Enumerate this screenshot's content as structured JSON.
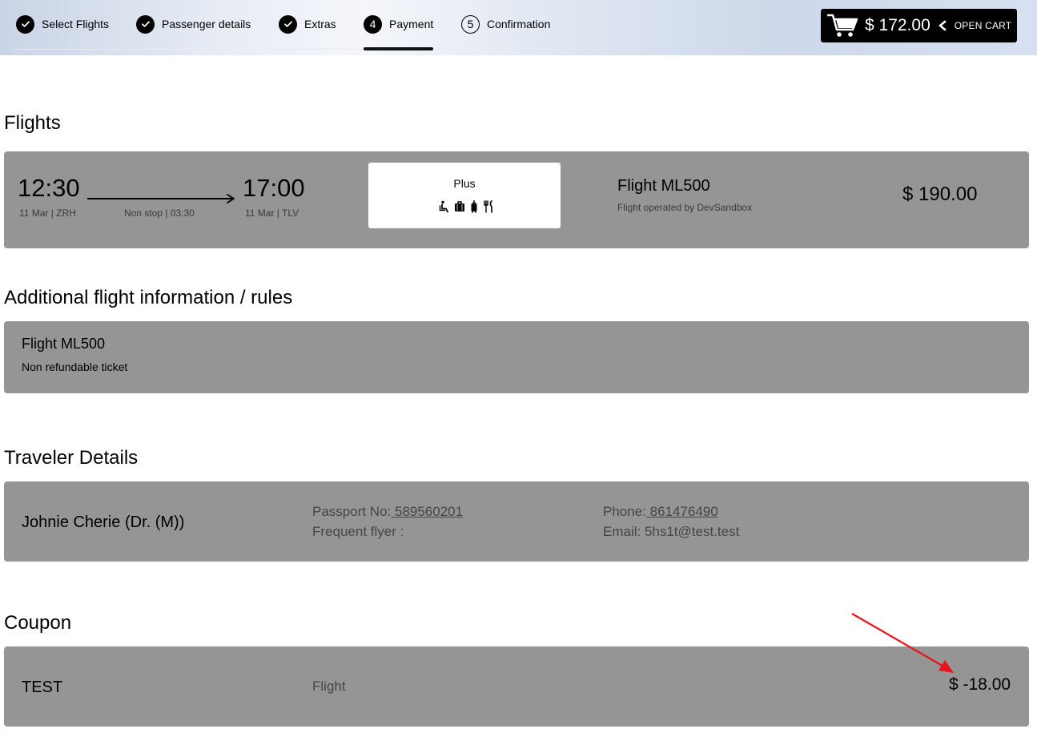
{
  "stepper": {
    "steps": [
      {
        "label": "Select Flights",
        "state": "done",
        "icon": "check-icon"
      },
      {
        "label": "Passenger details",
        "state": "done",
        "icon": "check-icon"
      },
      {
        "label": "Extras",
        "state": "done",
        "icon": "check-icon"
      },
      {
        "label": "Payment",
        "state": "active",
        "number": "4"
      },
      {
        "label": "Confirmation",
        "state": "upcoming",
        "number": "5"
      }
    ]
  },
  "cart": {
    "icon": "cart-icon",
    "total": "$ 172.00",
    "chevron_icon": "chevron-left-icon",
    "label": "OPEN CART"
  },
  "flights": {
    "heading": "Flights",
    "departure": {
      "time": "12:30",
      "detail": "11 Mar | ZRH"
    },
    "route": {
      "detail": "Non stop | 03:30"
    },
    "arrival": {
      "time": "17:00",
      "detail": "11 Mar | TLV"
    },
    "fare": {
      "name": "Plus",
      "amenity_icons": [
        "seat-recline-icon",
        "luggage-icon",
        "carry-on-bag-icon",
        "meal-icon"
      ]
    },
    "flight_number": "Flight ML500",
    "operated_by": "Flight operated by DevSandbox",
    "price": "$ 190.00"
  },
  "rules": {
    "heading": "Additional flight information / rules",
    "flight_number": "Flight ML500",
    "text": "Non refundable ticket"
  },
  "traveler": {
    "heading": "Traveler Details",
    "name": "Johnie Cherie (Dr. (M))",
    "passport_label": "Passport No:",
    "passport_value": " 589560201",
    "frequent_flyer_label": "Frequent flyer :",
    "phone_label": "Phone:",
    "phone_value": " 861476490",
    "email": "Email: 5hs1t@test.test"
  },
  "coupon": {
    "heading": "Coupon",
    "code": "TEST",
    "type": "Flight",
    "amount": "$ -18.00"
  },
  "annotation": {
    "color": "#e8141b"
  },
  "colors": {
    "panel_bg": "#959595",
    "cart_bg": "#000000"
  }
}
